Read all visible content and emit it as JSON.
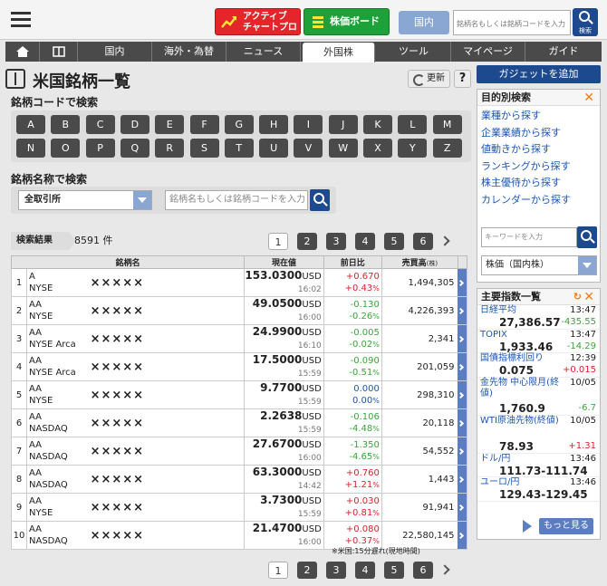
{
  "header": {
    "menu_icon": "hamburger-menu-icon",
    "active_chart_label_line1": "アクティブ",
    "active_chart_label_line2": "チャートプロ",
    "stock_board_label": "株価ボード",
    "market_tab": "国内",
    "search_placeholder": "銘柄名もしくは銘柄コードを入力",
    "search_button": "検索"
  },
  "nav": {
    "home_icon": "home-icon",
    "book_icon": "book-icon",
    "items": [
      "国内",
      "海外・為替",
      "ニュース",
      "外国株",
      "ツール",
      "マイページ",
      "ガイド"
    ],
    "active": "外国株"
  },
  "page": {
    "title": "米国銘柄一覧",
    "refresh_label": "更新",
    "help_label": "?"
  },
  "code_search": {
    "heading": "銘柄コードで検索",
    "letters": [
      "A",
      "B",
      "C",
      "D",
      "E",
      "F",
      "G",
      "H",
      "I",
      "J",
      "K",
      "L",
      "M",
      "N",
      "O",
      "P",
      "Q",
      "R",
      "S",
      "T",
      "U",
      "V",
      "W",
      "X",
      "Y",
      "Z"
    ]
  },
  "name_search": {
    "heading": "銘柄名称で検索",
    "exchange_selected": "全取引所",
    "placeholder": "銘柄名もしくは銘柄コードを入力"
  },
  "results": {
    "label": "検索結果",
    "count": "8591 件",
    "pages": [
      "1",
      "2",
      "3",
      "4",
      "5",
      "6"
    ],
    "current_page": "1",
    "columns": {
      "name": "銘柄名",
      "price": "現在値",
      "change": "前日比",
      "volume": "売買高",
      "volume_unit": "(株)"
    },
    "rows": [
      {
        "no": "1",
        "code": "A",
        "market": "NYSE",
        "name": "×××××",
        "price": "153.0300",
        "cur": "USD",
        "time": "16:02",
        "chg": "+0.670",
        "pct": "+0.43",
        "dir": "up",
        "vol": "1,494,305"
      },
      {
        "no": "2",
        "code": "AA",
        "market": "NYSE",
        "name": "×××××",
        "price": "49.0500",
        "cur": "USD",
        "time": "16:00",
        "chg": "-0.130",
        "pct": "-0.26",
        "dir": "dn",
        "vol": "4,226,393"
      },
      {
        "no": "3",
        "code": "AA",
        "market": "NYSE Arca",
        "name": "×××××",
        "price": "24.9900",
        "cur": "USD",
        "time": "16:10",
        "chg": "-0.005",
        "pct": "-0.02",
        "dir": "dn",
        "vol": "2,341"
      },
      {
        "no": "4",
        "code": "AA",
        "market": "NYSE Arca",
        "name": "×××××",
        "price": "17.5000",
        "cur": "USD",
        "time": "15:59",
        "chg": "-0.090",
        "pct": "-0.51",
        "dir": "dn",
        "vol": "201,059"
      },
      {
        "no": "5",
        "code": "AA",
        "market": "NYSE",
        "name": "×××××",
        "price": "9.7700",
        "cur": "USD",
        "time": "15:59",
        "chg": "0.000",
        "pct": "0.00",
        "dir": "fl",
        "vol": "298,310"
      },
      {
        "no": "6",
        "code": "AA",
        "market": "NASDAQ",
        "name": "×××××",
        "price": "2.2638",
        "cur": "USD",
        "time": "15:59",
        "chg": "-0.106",
        "pct": "-4.48",
        "dir": "dn",
        "vol": "20,118"
      },
      {
        "no": "7",
        "code": "AA",
        "market": "NASDAQ",
        "name": "×××××",
        "price": "27.6700",
        "cur": "USD",
        "time": "16:00",
        "chg": "-1.350",
        "pct": "-4.65",
        "dir": "dn",
        "vol": "54,552"
      },
      {
        "no": "8",
        "code": "AA",
        "market": "NASDAQ",
        "name": "×××××",
        "price": "63.3000",
        "cur": "USD",
        "time": "14:42",
        "chg": "+0.760",
        "pct": "+1.21",
        "dir": "up",
        "vol": "1,443"
      },
      {
        "no": "9",
        "code": "AA",
        "market": "NYSE",
        "name": "×××××",
        "price": "3.7300",
        "cur": "USD",
        "time": "15:59",
        "chg": "+0.030",
        "pct": "+0.81",
        "dir": "up",
        "vol": "91,941"
      },
      {
        "no": "10",
        "code": "AA",
        "market": "NASDAQ",
        "name": "×××××",
        "price": "21.4700",
        "cur": "USD",
        "time": "16:00",
        "chg": "+0.080",
        "pct": "+0.37",
        "dir": "up",
        "vol": "22,580,145"
      }
    ],
    "pct_unit": "%",
    "note": "※米国:15分遅れ(現地時間)"
  },
  "sidebar": {
    "gadget_button": "ガジェットを追加",
    "purpose_search": {
      "title": "目的別検索",
      "links": [
        "業種から探す",
        "企業業績から探す",
        "値動きから探す",
        "ランキングから探す",
        "株主優待から探す",
        "カレンダーから探す"
      ],
      "search_placeholder": "キーワードを入力",
      "select_value": "株価（国内株）"
    },
    "indices": {
      "title": "主要指数一覧",
      "items": [
        {
          "name": "日経平均",
          "time": "13:47",
          "value": "27,386.57",
          "change": "-435.55",
          "dir": "dn"
        },
        {
          "name": "TOPIX",
          "time": "13:47",
          "value": "1,933.46",
          "change": "-14.29",
          "dir": "dn"
        },
        {
          "name": "国債指標利回り",
          "time": "12:39",
          "value": "0.075",
          "change": "+0.015",
          "dir": "up"
        },
        {
          "name": "金先物 中心限月(終値)",
          "time": "10/05",
          "value": "1,760.9",
          "change": "-6.7",
          "dir": "dn"
        },
        {
          "name": "WTI原油先物(終値)",
          "time": "10/05",
          "value": "78.93",
          "change": "+1.31",
          "dir": "up"
        },
        {
          "name": "ドル/円",
          "time": "13:46",
          "value": "111.73-111.74",
          "change": "",
          "dir": ""
        },
        {
          "name": "ユーロ/円",
          "time": "13:46",
          "value": "129.43-129.45",
          "change": "",
          "dir": ""
        }
      ],
      "more_label": "もっと見る"
    }
  }
}
